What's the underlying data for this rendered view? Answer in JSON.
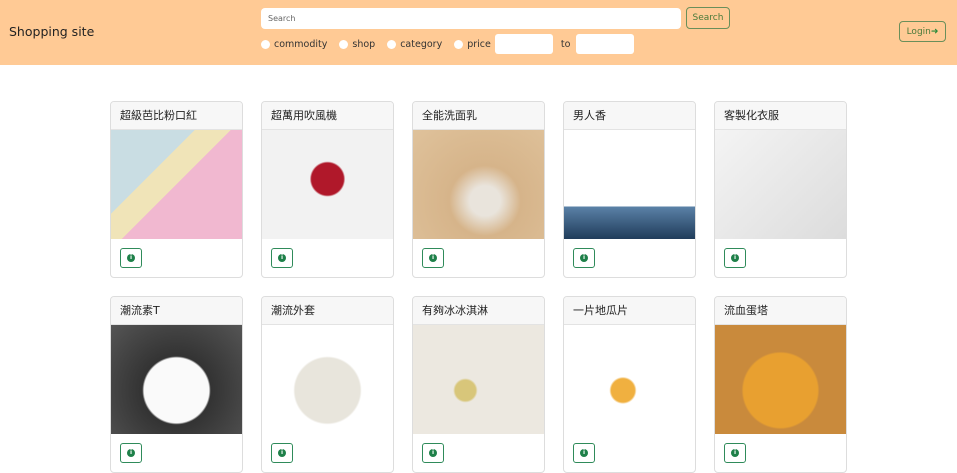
{
  "header": {
    "brand": "Shopping site",
    "search_placeholder": "Search",
    "search_button": "Search",
    "login_button": "Login",
    "filters": [
      "commodity",
      "shop",
      "category",
      "price"
    ],
    "price_to": "to"
  },
  "products": [
    {
      "name": "超級芭比粉口紅",
      "image": "linear-gradient(135deg,#c9dde3 0 35%,#f0e4b8 35% 50%,#f1b8d0 50%)"
    },
    {
      "name": "超萬用吹風機",
      "image": "radial-gradient(circle at 50% 45%,#b0182a 0 18%,#f2f2f2 20%)"
    },
    {
      "name": "全能洗面乳",
      "image": "radial-gradient(ellipse at 55% 65%,#e9e4dc 0 15%,#d6b48a 35%,#dfc29b)"
    },
    {
      "name": "男人香",
      "image": "linear-gradient(180deg,#fff 0 70%,#5b82a8 70%,#203c5a)"
    },
    {
      "name": "客製化衣服",
      "image": "linear-gradient(135deg,#f4f4f4,#dcdcdc)"
    },
    {
      "name": "潮流素T",
      "image": "radial-gradient(ellipse at 50% 60%,#fafafa 0 35%,#333 37%,#555)"
    },
    {
      "name": "潮流外套",
      "image": "radial-gradient(ellipse at 50% 60%,#e8e5dc 0 35%,#fff 37%)"
    },
    {
      "name": "有夠冰冰淇淋",
      "image": "radial-gradient(circle at 40% 60%,#d8c67a 0 10%,#ece8e0 12%)"
    },
    {
      "name": "一片地瓜片",
      "image": "radial-gradient(circle at 45% 60%,#f0b040 0 12%,#fff 14%)"
    },
    {
      "name": "流血蛋塔",
      "image": "radial-gradient(ellipse at 50% 60%,#e8a030 0 40%,#c98a3c 42%)"
    }
  ]
}
